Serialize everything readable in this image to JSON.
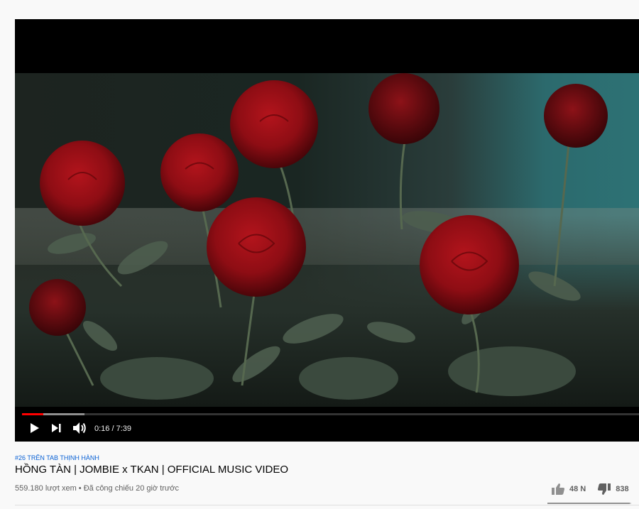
{
  "player": {
    "time_display": "0:16 / 7:39",
    "played_fraction": 0.035,
    "buffered_fraction": 0.101,
    "thumbnail_description_icon": "video-frame"
  },
  "video": {
    "hashtag": "#26 TRÊN TAB THỊNH HÀNH",
    "title": "HỒNG TÀN | JOMBIE x TKAN | OFFICIAL MUSIC VIDEO",
    "meta": "559.180 lượt xem • Đã công chiếu 20 giờ trước"
  },
  "actions": {
    "like_count": "48 N",
    "dislike_count": "838",
    "like_fraction": 0.98
  },
  "icons": {
    "play": "play-icon",
    "next": "next-icon",
    "volume": "volume-icon",
    "like": "thumbs-up-icon",
    "dislike": "thumbs-down-icon"
  },
  "colors": {
    "progress": "#ff0000",
    "hashtag": "#065fd4",
    "title": "#030303",
    "meta": "#606060"
  }
}
